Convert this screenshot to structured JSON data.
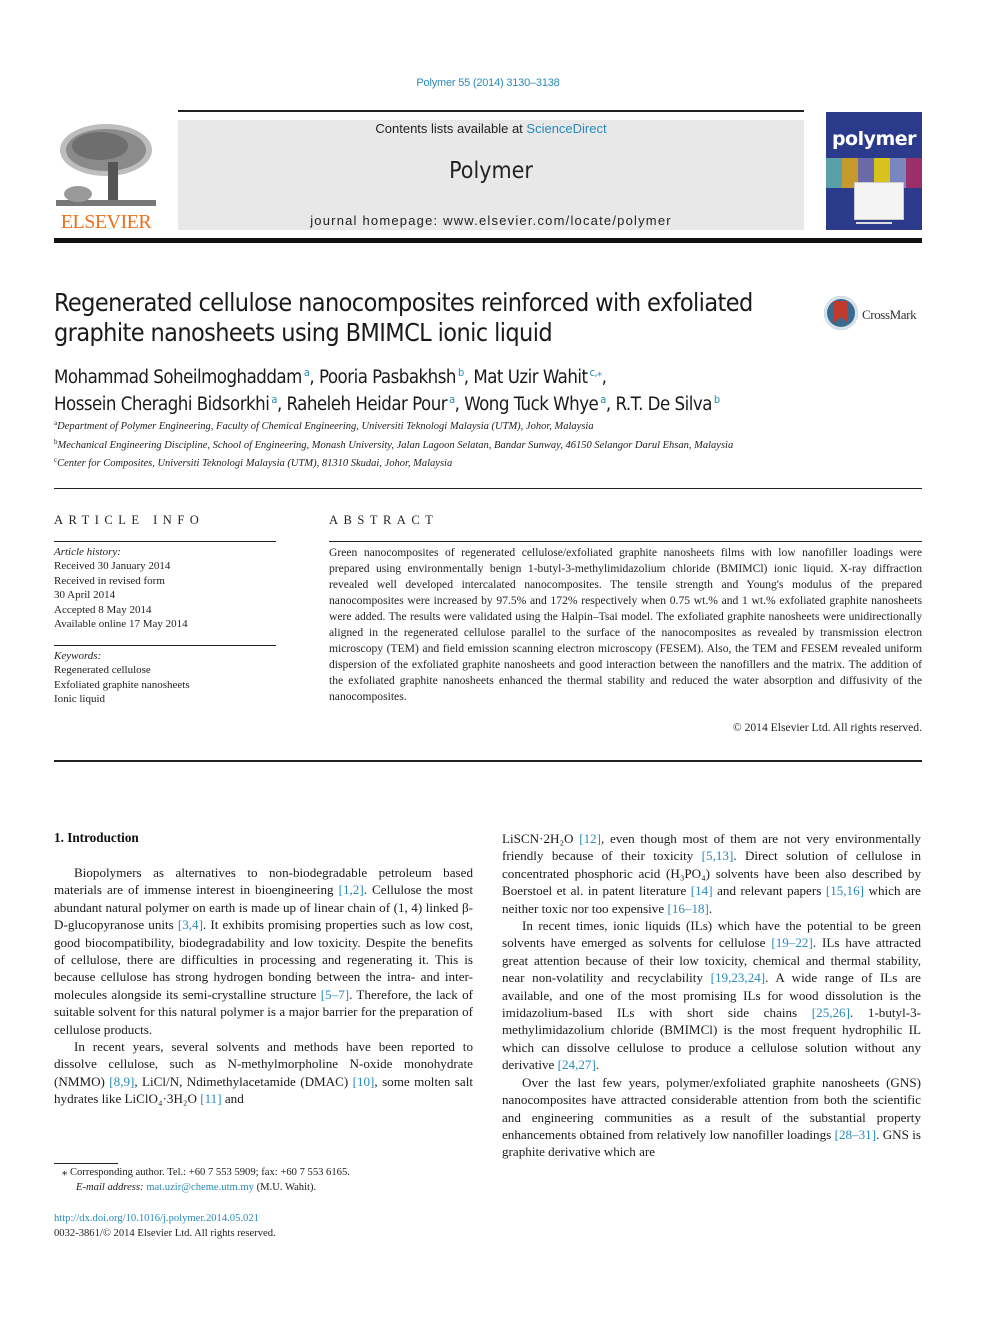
{
  "header": {
    "citation": "Polymer 55 (2014) 3130–3138",
    "contents_prefix": "Contents lists available at ",
    "contents_link": "ScienceDirect",
    "journal_name": "Polymer",
    "homepage": "journal homepage: www.elsevier.com/locate/polymer",
    "publisher_logo": "ELSEVIER",
    "cover_title": "polymer",
    "crossmark_label": "CrossMark"
  },
  "article": {
    "title_lines": [
      "Regenerated cellulose nanocomposites reinforced with exfoliated",
      "graphite nanosheets using BMIMCL ionic liquid"
    ],
    "authors": [
      {
        "name": "Mohammad Soheilmoghaddam",
        "aff": "a",
        "sep": ", "
      },
      {
        "name": "Pooria Pasbakhsh",
        "aff": "b",
        "sep": ", "
      },
      {
        "name": "Mat Uzir Wahit",
        "aff": "c,⁎",
        "sep": ","
      },
      {
        "name": "Hossein Cheraghi Bidsorkhi",
        "aff": "a",
        "sep": ", "
      },
      {
        "name": "Raheleh Heidar Pour",
        "aff": "a",
        "sep": ", "
      },
      {
        "name": "Wong Tuck Whye",
        "aff": "a",
        "sep": ", "
      },
      {
        "name": "R.T. De Silva",
        "aff": "b",
        "sep": ""
      }
    ],
    "affiliations": [
      {
        "key": "a",
        "text": "Department of Polymer Engineering, Faculty of Chemical Engineering, Universiti Teknologi Malaysia (UTM), Johor, Malaysia"
      },
      {
        "key": "b",
        "text": "Mechanical Engineering Discipline, School of Engineering, Monash University, Jalan Lagoon Selatan, Bandar Sunway, 46150 Selangor Darul Ehsan, Malaysia"
      },
      {
        "key": "c",
        "text": "Center for Composites, Universiti Teknologi Malaysia (UTM), 81310 Skudai, Johor, Malaysia"
      }
    ]
  },
  "article_info": {
    "heading": "ARTICLE INFO",
    "history_label": "Article history:",
    "history": [
      "Received 30 January 2014",
      "Received in revised form",
      "30 April 2014",
      "Accepted 8 May 2014",
      "Available online 17 May 2014"
    ],
    "keywords_label": "Keywords:",
    "keywords": [
      "Regenerated cellulose",
      "Exfoliated graphite nanosheets",
      "Ionic liquid"
    ]
  },
  "abstract": {
    "heading": "ABSTRACT",
    "text": "Green nanocomposites of regenerated cellulose/exfoliated graphite nanosheets films with low nanofiller loadings were prepared using environmentally benign 1-butyl-3-methylimidazolium chloride (BMIMCl) ionic liquid. X-ray diffraction revealed well developed intercalated nanocomposites. The tensile strength and Young's modulus of the prepared nanocomposites were increased by 97.5% and 172% respectively when 0.75 wt.% and 1 wt.% exfoliated graphite nanosheets were added. The results were validated using the Halpin–Tsai model. The exfoliated graphite nanosheets were unidirectionally aligned in the regenerated cellulose parallel to the surface of the nanocomposites as revealed by transmission electron microscopy (TEM) and field emission scanning electron microscopy (FESEM). Also, the TEM and FESEM revealed uniform dispersion of the exfoliated graphite nanosheets and good interaction between the nanofillers and the matrix. The addition of the exfoliated graphite nanosheets enhanced the thermal stability and reduced the water absorption and diffusivity of the nanocomposites.",
    "copyright": "© 2014 Elsevier Ltd. All rights reserved."
  },
  "body": {
    "section_heading": "1.  Introduction",
    "left_paragraphs": [
      [
        {
          "t": "Biopolymers as alternatives to non-biodegradable petroleum based materials are of immense interest in bioengineering "
        },
        {
          "ref": "[1,2]"
        },
        {
          "t": ". Cellulose the most abundant natural polymer on earth is made up of linear chain of (1, 4) linked β-D-glucopyranose units "
        },
        {
          "ref": "[3,4]"
        },
        {
          "t": ". It exhibits promising properties such as low cost, good biocompatibility, biodegradability and low toxicity. Despite the benefits of cellulose, there are difficulties in processing and regenerating it. This is because cellulose has strong hydrogen bonding between the intra- and inter-molecules alongside its semi-crystalline structure "
        },
        {
          "ref": "[5–7]"
        },
        {
          "t": ". Therefore, the lack of suitable solvent for this natural polymer is a major barrier for the preparation of cellulose products."
        }
      ],
      [
        {
          "t": "In recent years, several solvents and methods have been reported to dissolve cellulose, such as N-methylmorpholine N-oxide monohydrate (NMMO) "
        },
        {
          "ref": "[8,9]"
        },
        {
          "t": ", LiCl/N, Ndimethylacetamide (DMAC) "
        },
        {
          "ref": "[10]"
        },
        {
          "t": ", some molten salt hydrates like LiClO₄·3H₂O "
        },
        {
          "ref": "[11]"
        },
        {
          "t": " and"
        }
      ]
    ],
    "right_paragraphs": [
      [
        {
          "t": "LiSCN·2H₂O "
        },
        {
          "ref": "[12]"
        },
        {
          "t": ", even though most of them are not very environmentally friendly because of their toxicity "
        },
        {
          "ref": "[5,13]"
        },
        {
          "t": ". Direct solution of cellulose in concentrated phosphoric acid (H₃PO₄) solvents have been also described by Boerstoel et al. in patent literature "
        },
        {
          "ref": "[14]"
        },
        {
          "t": " and relevant papers "
        },
        {
          "ref": "[15,16]"
        },
        {
          "t": " which are neither toxic nor too expensive "
        },
        {
          "ref": "[16–18]"
        },
        {
          "t": "."
        }
      ],
      [
        {
          "t": "In recent times, ionic liquids (ILs) which have the potential to be green solvents have emerged as solvents for cellulose "
        },
        {
          "ref": "[19–22]"
        },
        {
          "t": ". ILs have attracted great attention because of their low toxicity, chemical and thermal stability, near non-volatility and recyclability "
        },
        {
          "ref": "[19,23,24]"
        },
        {
          "t": ". A wide range of ILs are available, and one of the most promising ILs for wood dissolution is the imidazolium-based ILs with short side chains "
        },
        {
          "ref": "[25,26]"
        },
        {
          "t": ". 1-butyl-3-methylimidazolium chloride (BMIMCl) is the most frequent hydrophilic IL which can dissolve cellulose to produce a cellulose solution without any derivative "
        },
        {
          "ref": "[24,27]"
        },
        {
          "t": "."
        }
      ],
      [
        {
          "t": "Over the last few years, polymer/exfoliated graphite nanosheets (GNS) nanocomposites have attracted considerable attention from both the scientific and engineering communities as a result of the substantial property enhancements obtained from relatively low nanofiller loadings "
        },
        {
          "ref": "[28–31]"
        },
        {
          "t": ". GNS is graphite derivative which are"
        }
      ]
    ]
  },
  "footnotes": {
    "corresponding": "⁎  Corresponding author. Tel.: +60 7 553 5909; fax: +60 7 553 6165.",
    "email_label": "E-mail address: ",
    "email": "mat.uzir@cheme.utm.my",
    "email_suffix": " (M.U. Wahit).",
    "doi": "http://dx.doi.org/10.1016/j.polymer.2014.05.021",
    "issn": "0032-3861/© 2014 Elsevier Ltd. All rights reserved."
  },
  "colors": {
    "link": "#2a8ab8",
    "elsevier_orange": "#e9711c",
    "cover_blue": "#2c3a8c",
    "masthead_gray": "#e8e8e8"
  }
}
